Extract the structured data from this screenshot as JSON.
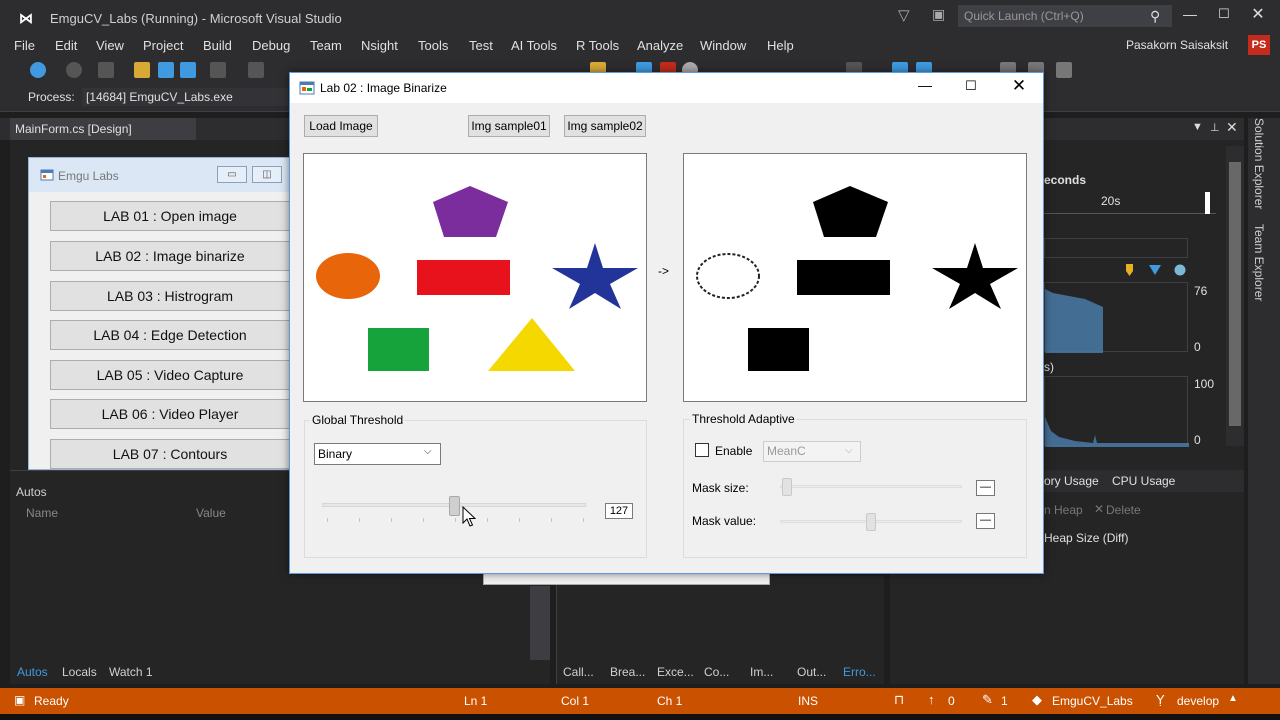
{
  "vs": {
    "title": "EmguCV_Labs (Running) - Microsoft Visual Studio",
    "quick_launch_placeholder": "Quick Launch (Ctrl+Q)",
    "menu": [
      "File",
      "Edit",
      "View",
      "Project",
      "Build",
      "Debug",
      "Team",
      "Nsight",
      "Tools",
      "Test",
      "AI Tools",
      "R Tools",
      "Analyze",
      "Window",
      "Help"
    ],
    "user_name": "Pasakorn Saisaksit",
    "user_initials": "PS",
    "process_label": "Process:",
    "process_value": "[14684] EmguCV_Labs.exe",
    "accent_color": "#ca5100"
  },
  "designer": {
    "tab_label": "MainForm.cs [Design]",
    "form_title": "Emgu Labs",
    "lab_buttons": [
      "LAB 01 : Open image",
      "LAB 02 : Image binarize",
      "LAB 03 : Histrogram",
      "LAB 04 : Edge Detection",
      "LAB 05 : Video Capture",
      "LAB 06 : Video Player",
      "LAB 07 : Contours"
    ]
  },
  "autos": {
    "title": "Autos",
    "col_name": "Name",
    "col_value": "Value",
    "tabs": [
      "Autos",
      "Locals",
      "Watch 1"
    ]
  },
  "bottom_mid_tabs": [
    "Call...",
    "Brea...",
    "Exce...",
    "Co...",
    "Im...",
    "Out...",
    "Erro..."
  ],
  "diagnostics": {
    "seconds_frag": "econds",
    "ruler_label": "20s",
    "memory_max": "76",
    "memory_min": "0",
    "cpu_label_frag": "s)",
    "cpu_max": "100",
    "cpu_min": "0",
    "tab_memory": "ory Usage",
    "tab_cpu": "CPU Usage",
    "btn_heap": "n Heap",
    "btn_delete": "Delete",
    "col_heap_diff": "Heap Size (Diff)"
  },
  "side_tabs": [
    "Solution Explorer",
    "Team Explorer"
  ],
  "status": {
    "ready": "Ready",
    "ln": "Ln 1",
    "col": "Col 1",
    "ch": "Ch 1",
    "ins": "INS",
    "up_count": "0",
    "edit_count": "1",
    "repo": "EmguCV_Labs",
    "branch": "develop"
  },
  "dialog": {
    "title": "Lab 02 : Image Binarize",
    "load_button": "Load Image",
    "sample1_button": "Img sample01",
    "sample2_button": "Img sample02",
    "arrow": "->",
    "global_group_label": "Global Threshold",
    "threshold_type": "Binary",
    "threshold_value": "127",
    "threshold_fraction": 0.5,
    "adaptive_group_label": "Threshold Adaptive",
    "enable_label": "Enable",
    "enable_checked": false,
    "adaptive_method": "MeanC",
    "mask_size_label": "Mask size:",
    "mask_value_label": "Mask value:",
    "shape_colors": {
      "pentagon": "#7b2d9e",
      "ellipse": "#e8650a",
      "rectangle": "#e8121c",
      "star": "#22349a",
      "square": "#16a33c",
      "triangle": "#f5d800"
    }
  }
}
